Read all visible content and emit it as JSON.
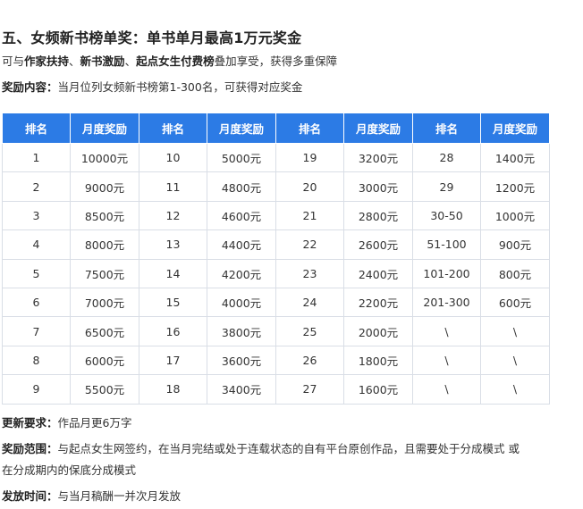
{
  "title": "五、女频新书榜单奖：单书单月最高1万元奖金",
  "intro": {
    "prefix": "可与",
    "bold1": "作家扶持",
    "sep1": "、",
    "bold2": "新书激励",
    "sep2": "、",
    "bold3": "起点女生付费榜",
    "suffix": "叠加享受，获得多重保障"
  },
  "reward_content": {
    "label": "奖励内容：",
    "text": "当月位列女频新书榜第1-300名，可获得对应奖金"
  },
  "table": {
    "headers": [
      "排名",
      "月度奖励",
      "排名",
      "月度奖励",
      "排名",
      "月度奖励",
      "排名",
      "月度奖励"
    ],
    "rows": [
      [
        "1",
        "10000元",
        "10",
        "5000元",
        "19",
        "3200元",
        "28",
        "1400元"
      ],
      [
        "2",
        "9000元",
        "11",
        "4800元",
        "20",
        "3000元",
        "29",
        "1200元"
      ],
      [
        "3",
        "8500元",
        "12",
        "4600元",
        "21",
        "2800元",
        "30-50",
        "1000元"
      ],
      [
        "4",
        "8000元",
        "13",
        "4400元",
        "22",
        "2600元",
        "51-100",
        "900元"
      ],
      [
        "5",
        "7500元",
        "14",
        "4200元",
        "23",
        "2400元",
        "101-200",
        "800元"
      ],
      [
        "6",
        "7000元",
        "15",
        "4000元",
        "24",
        "2200元",
        "201-300",
        "600元"
      ],
      [
        "7",
        "6500元",
        "16",
        "3800元",
        "25",
        "2000元",
        "\\",
        "\\"
      ],
      [
        "8",
        "6000元",
        "17",
        "3600元",
        "26",
        "1800元",
        "\\",
        "\\"
      ],
      [
        "9",
        "5500元",
        "18",
        "3400元",
        "27",
        "1600元",
        "\\",
        "\\"
      ]
    ]
  },
  "update_req": {
    "label": "更新要求：",
    "text": "作品月更6万字"
  },
  "scope": {
    "label": "奖励范围：",
    "text1": "与起点女生网签约，在当月完结或处于连载状态的自有平台原创作品，且需要处于分成模式 或",
    "text2": "在分成期内的保底分成模式"
  },
  "issue_time": {
    "label": "发放时间：",
    "text": "与当月稿酬一并次月发放"
  },
  "colors": {
    "header_bg": "#2c7be5",
    "header_text": "#ffffff",
    "cell_border": "#d9dee6"
  }
}
